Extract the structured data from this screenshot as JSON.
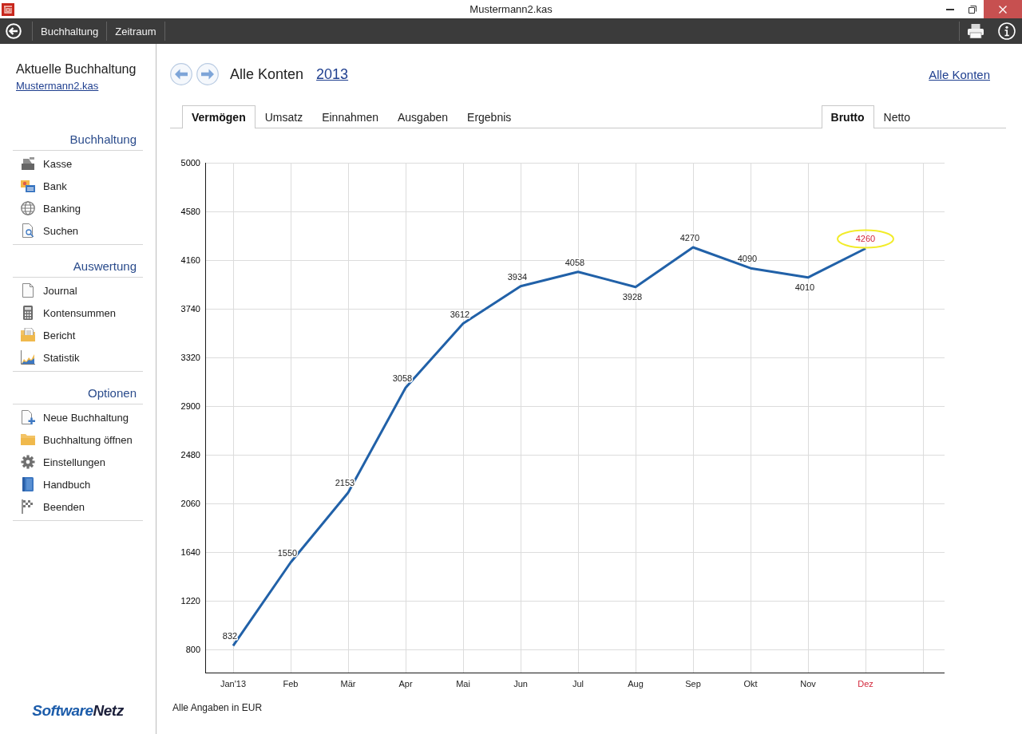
{
  "window": {
    "title": "Mustermann2.kas"
  },
  "toolbar": {
    "items": [
      "Buchhaltung",
      "Zeitraum"
    ]
  },
  "sidebar": {
    "heading": "Aktuelle Buchhaltung",
    "file_link": "Mustermann2.kas",
    "sections": [
      {
        "title": "Buchhaltung",
        "items": [
          "Kasse",
          "Bank",
          "Banking",
          "Suchen"
        ]
      },
      {
        "title": "Auswertung",
        "items": [
          "Journal",
          "Kontensummen",
          "Bericht",
          "Statistik"
        ]
      },
      {
        "title": "Optionen",
        "items": [
          "Neue Buchhaltung",
          "Buchhaltung öffnen",
          "Einstellungen",
          "Handbuch",
          "Beenden"
        ]
      }
    ],
    "logo": {
      "first": "Software",
      "second": "Netz"
    }
  },
  "header": {
    "title": "Alle Konten",
    "year": "2013",
    "right_link": "Alle Konten"
  },
  "tabs": [
    {
      "label": "Vermögen",
      "selected": true
    },
    {
      "label": "Umsatz",
      "selected": false
    },
    {
      "label": "Einnahmen",
      "selected": false
    },
    {
      "label": "Ausgaben",
      "selected": false
    },
    {
      "label": "Ergebnis",
      "selected": false
    }
  ],
  "mode_tabs": [
    {
      "label": "Brutto",
      "selected": true
    },
    {
      "label": "Netto",
      "selected": false
    }
  ],
  "chart": {
    "chart_data": {
      "type": "line",
      "categories": [
        "Jan'13",
        "Feb",
        "Mär",
        "Apr",
        "Mai",
        "Jun",
        "Jul",
        "Aug",
        "Sep",
        "Okt",
        "Nov",
        "Dez"
      ],
      "values": [
        832,
        1550,
        2153,
        3058,
        3612,
        3934,
        4058,
        3928,
        4270,
        4090,
        4010,
        4260
      ],
      "ylim": [
        600,
        5000
      ],
      "yticks": [
        800,
        1220,
        1640,
        2060,
        2480,
        2900,
        3320,
        3740,
        4160,
        4580,
        5000
      ],
      "grid": true,
      "data_labels": true,
      "annotations": [
        {
          "x": "Dez"
        }
      ]
    }
  },
  "footnote": "Alle Angaben in EUR"
}
